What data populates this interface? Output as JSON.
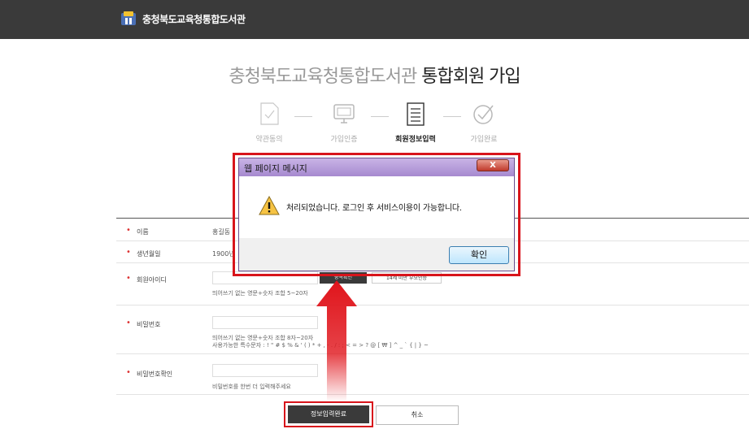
{
  "header": {
    "logo_text": "충청북도교육청통합도서관"
  },
  "title": {
    "library": "충청북도교육청통합도서관",
    "join": "통합회원 가입"
  },
  "steps": [
    {
      "label": "약관동의",
      "icon": "document-check-icon",
      "active": false
    },
    {
      "label": "가입인증",
      "icon": "monitor-icon",
      "active": false
    },
    {
      "label": "회원정보입력",
      "icon": "form-list-icon",
      "active": true
    },
    {
      "label": "가입완료",
      "icon": "circle-check-icon",
      "active": false
    }
  ],
  "form": {
    "name_label": "이름",
    "name_value": "홍길동",
    "birth_label": "생년월일",
    "birth_value": "1900년",
    "id_label": "회원아이디",
    "id_dup_button": "중복확인",
    "id_under14_button": "14세 미만 부모인증",
    "id_hint": "띄어쓰기 없는 영문+숫자 조합 5~20자",
    "pw_label": "비밀번호",
    "pw_hint1": "띄어쓰기 없는 영문+숫자 조합 8자~20자",
    "pw_hint2": "사용가능한 특수문자 : ! \" # $ % & ' ( ) * + , - . / : ; < = > ? @ [ ₩ ] ^ _ ` { | } ~",
    "pw_confirm_label": "비밀번호확인",
    "pw_confirm_hint": "비밀번호를 한번 더 입력해주세요"
  },
  "buttons": {
    "submit": "정보입력완료",
    "cancel": "취소"
  },
  "dialog": {
    "title": "웹 페이지 메시지",
    "close": "X",
    "message": "처리되었습니다. 로그인 후 서비스이용이 가능합니다.",
    "ok": "확인"
  },
  "colors": {
    "header_bg": "#3a3a3a",
    "highlight": "#d8141b",
    "required_dot": "#dd3333"
  }
}
